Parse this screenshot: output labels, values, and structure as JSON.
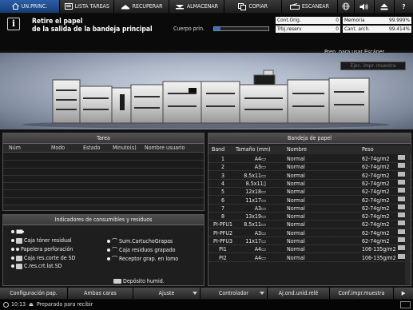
{
  "top_tabs": [
    {
      "label": "UN.PRINC.",
      "icon": "house-icon",
      "active": true
    },
    {
      "label": "LISTA TAREAS",
      "icon": "list-icon",
      "active": false
    },
    {
      "label": "RECUPERAR",
      "icon": "recall-icon",
      "active": false
    },
    {
      "label": "ALMACENAR",
      "icon": "store-icon",
      "active": false
    },
    {
      "label": "COPIAR",
      "icon": "copy-icon",
      "active": false
    },
    {
      "label": "ESCANEAR",
      "icon": "scan-icon",
      "active": false
    }
  ],
  "message": {
    "line1": "Retire el papel",
    "line2": "de la salida de la bandeja principal"
  },
  "paper_level": {
    "label": "Cuerpo prin.",
    "fraction": 0.12
  },
  "counters": {
    "cont_orig_label": "Cont.Orig.",
    "cont_orig_value": "0",
    "trbj_reserv_label": "Trbj.reserv",
    "trbj_reserv_value": "0",
    "memoria_label": "Memoria",
    "memoria_value": "99.999%",
    "cant_arch_label": "Cant. arch.",
    "cant_arch_value": "99.414%"
  },
  "status_ready": "Prep. para usar Escáner",
  "ejec_button": "Ejec. impr. muestra",
  "task_panel": {
    "title": "Tarea",
    "columns": [
      "Núm",
      "Modo",
      "Estado",
      "Minuto(s)",
      "Nombre usuario"
    ]
  },
  "consumables": {
    "title": "Indicadores de consumibles y residuos",
    "items": [
      "Caja tóner residual",
      "Papelera perforación",
      "Caja res.corte de SD",
      "C.res.crt.lat.SD",
      "Sum.CartuchoGrapas",
      "Caja residuos grapado",
      "Receptor grap. en lomo",
      "Depósito humid."
    ]
  },
  "tray_panel": {
    "title": "Bandeja de papel",
    "columns": [
      "Band",
      "Tamaño (mm)",
      "Nombre",
      "Peso"
    ],
    "rows": [
      {
        "band": "1",
        "size": "A4▭",
        "name": "Normal",
        "weight": "62-74g/m2"
      },
      {
        "band": "2",
        "size": "A3▭",
        "name": "Normal",
        "weight": "62-74g/m2"
      },
      {
        "band": "3",
        "size": "8.5x11▭",
        "name": "Normal",
        "weight": "62-74g/m2"
      },
      {
        "band": "4",
        "size": "8.5x11▯",
        "name": "Normal",
        "weight": "62-74g/m2"
      },
      {
        "band": "5",
        "size": "12x18▭",
        "name": "Normal",
        "weight": "62-74g/m2"
      },
      {
        "band": "6",
        "size": "11x17▭",
        "name": "Normal",
        "weight": "62-74g/m2"
      },
      {
        "band": "7",
        "size": "A3▭",
        "name": "Normal",
        "weight": "62-74g/m2"
      },
      {
        "band": "8",
        "size": "13x19▭",
        "name": "Normal",
        "weight": "62-74g/m2"
      },
      {
        "band": "PI-PFU1",
        "size": "8.5x11▭",
        "name": "Normal",
        "weight": "62-74g/m2"
      },
      {
        "band": "PI-PFU2",
        "size": "A3▭",
        "name": "Normal",
        "weight": "62-74g/m2"
      },
      {
        "band": "PI-PFU3",
        "size": "11x17▭",
        "name": "Normal",
        "weight": "62-74g/m2"
      },
      {
        "band": "PI1",
        "size": "A4▭",
        "name": "Normal",
        "weight": "106-135g/m2"
      },
      {
        "band": "PI2",
        "size": "A4▭",
        "name": "Normal",
        "weight": "106-135g/m2"
      }
    ]
  },
  "bottom_buttons": [
    "Configuración pap.",
    "Ambas caras",
    "Ajuste",
    "Controlador",
    "Aj.ond.unid.relé",
    "Conf.impr.muestra"
  ],
  "clock": "10:13",
  "status_message": "Preparada para recibir"
}
